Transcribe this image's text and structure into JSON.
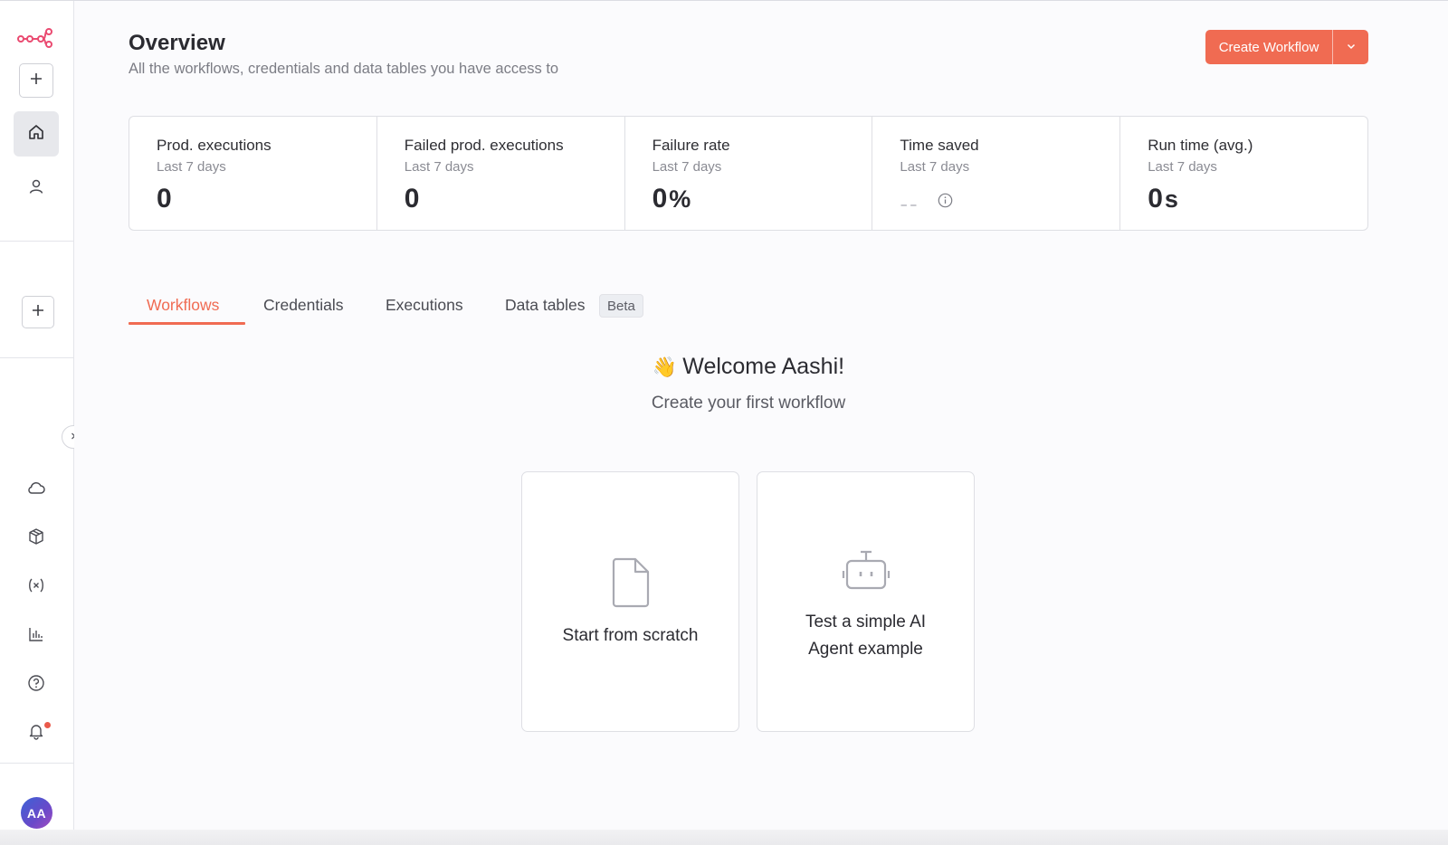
{
  "header": {
    "title": "Overview",
    "subtitle": "All the workflows, credentials and data tables you have access to",
    "create_label": "Create Workflow",
    "accent": "#f06b52"
  },
  "sidebar": {
    "top_items": [
      {
        "name": "logo",
        "icon": "n8n-logo"
      },
      {
        "name": "add",
        "icon": "plus-icon"
      },
      {
        "name": "home",
        "icon": "home-icon",
        "active": true
      },
      {
        "name": "personal",
        "icon": "user-icon"
      }
    ],
    "project_add_icon": "plus-icon",
    "bottom_items": [
      {
        "name": "cloud",
        "icon": "cloud-icon"
      },
      {
        "name": "templates",
        "icon": "box-icon"
      },
      {
        "name": "variables",
        "icon": "variables-icon"
      },
      {
        "name": "insights",
        "icon": "chart-icon"
      },
      {
        "name": "help",
        "icon": "help-icon"
      },
      {
        "name": "notifications",
        "icon": "bell-icon"
      }
    ],
    "avatar_initials": "AA"
  },
  "stats": [
    {
      "label": "Prod. executions",
      "sub": "Last 7 days",
      "value": "0",
      "unit": ""
    },
    {
      "label": "Failed prod. executions",
      "sub": "Last 7 days",
      "value": "0",
      "unit": ""
    },
    {
      "label": "Failure rate",
      "sub": "Last 7 days",
      "value": "0",
      "unit": "%"
    },
    {
      "label": "Time saved",
      "sub": "Last 7 days",
      "value": "--",
      "unit": ""
    },
    {
      "label": "Run time (avg.)",
      "sub": "Last 7 days",
      "value": "0",
      "unit": "s"
    }
  ],
  "tabs": [
    {
      "label": "Workflows",
      "active": true
    },
    {
      "label": "Credentials"
    },
    {
      "label": "Executions"
    },
    {
      "label": "Data tables",
      "badge": "Beta"
    }
  ],
  "welcome": {
    "emoji": "👋",
    "title": "Welcome Aashi!",
    "subtitle": "Create your first workflow"
  },
  "cards": [
    {
      "label": "Start from scratch",
      "icon": "file-icon"
    },
    {
      "label_line1": "Test a simple AI",
      "label_line2": "Agent example",
      "icon": "robot-icon"
    }
  ]
}
